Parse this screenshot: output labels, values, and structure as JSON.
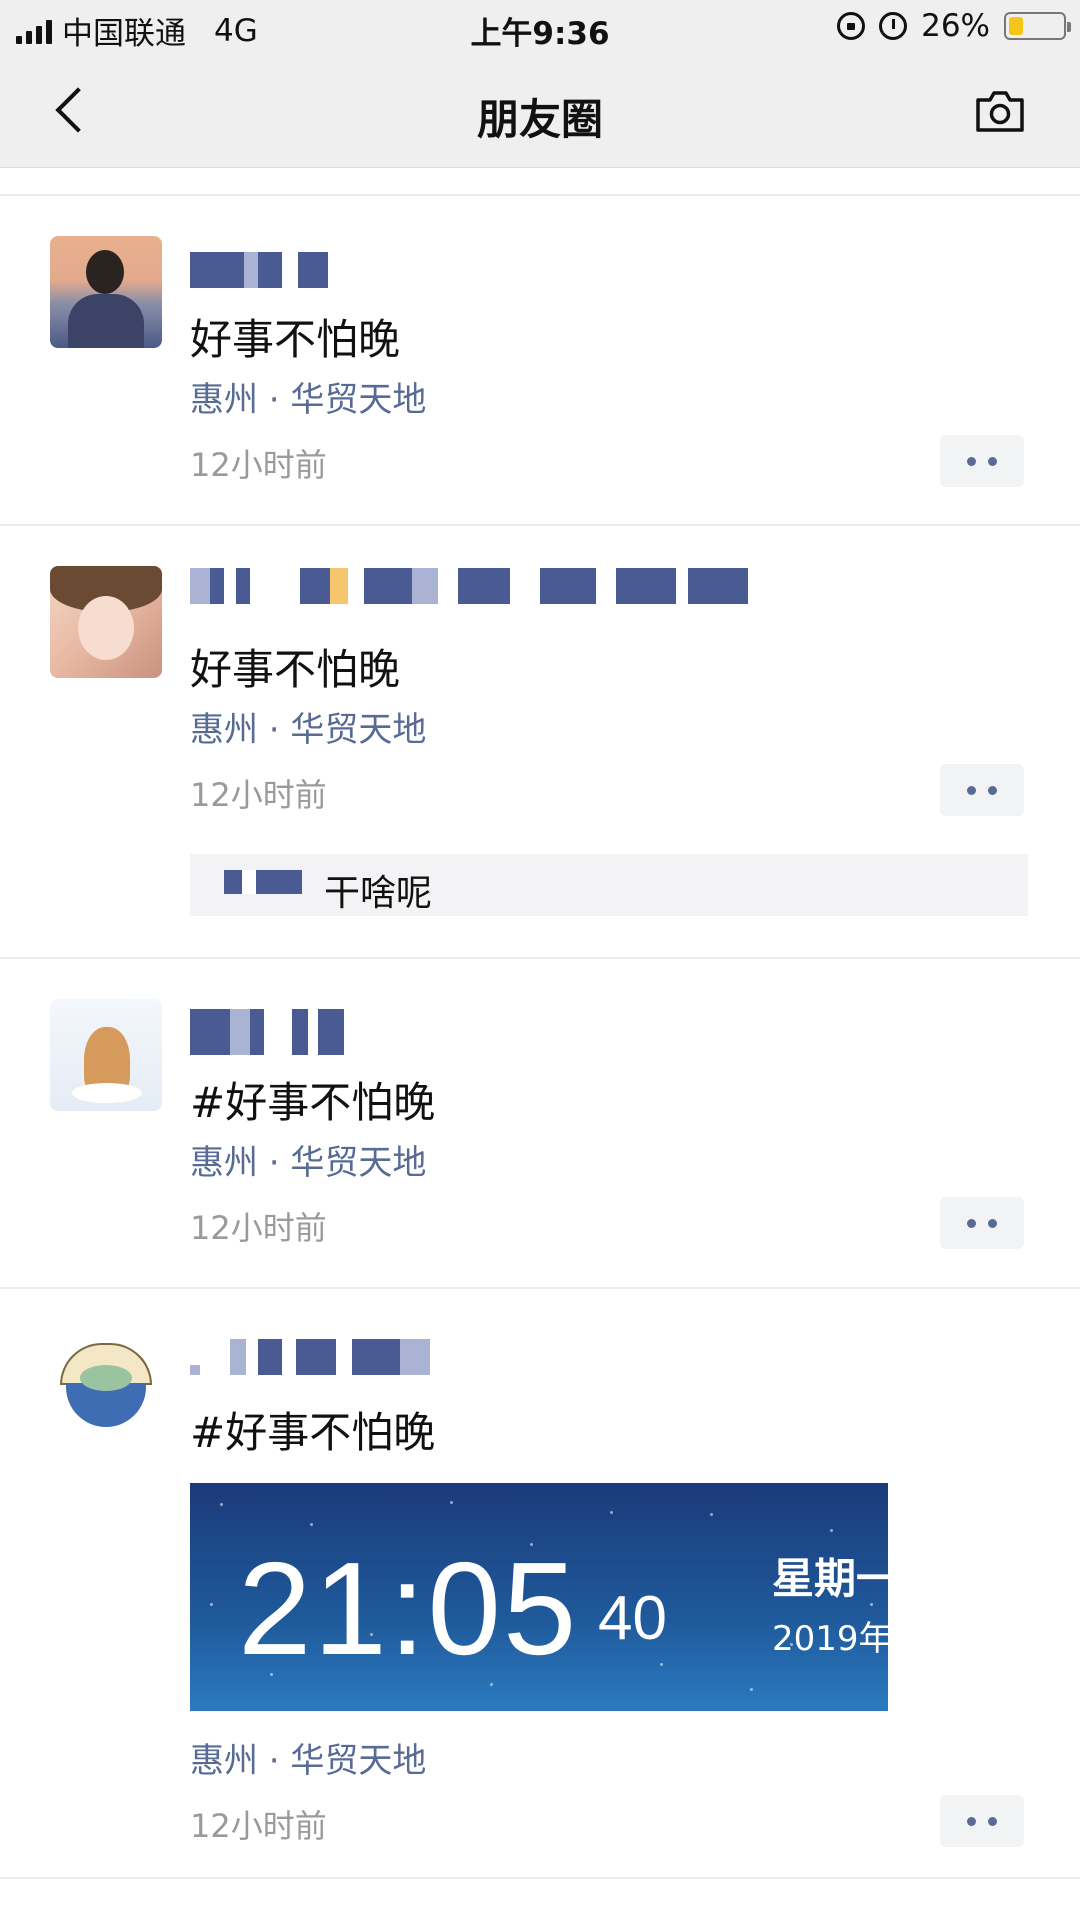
{
  "status_bar": {
    "carrier": "中国联通",
    "network": "4G",
    "time": "上午9:36",
    "battery": "26%",
    "battery_level": 0.26
  },
  "nav": {
    "title": "朋友圈"
  },
  "posts": [
    {
      "text": "好事不怕晚",
      "location": "惠州 · 华贸天地",
      "time_ago": "12小时前"
    },
    {
      "text": "好事不怕晚",
      "location": "惠州 · 华贸天地",
      "time_ago": "12小时前",
      "comment": "干啥呢"
    },
    {
      "text": "#好事不怕晚",
      "location": "惠州 · 华贸天地",
      "time_ago": "12小时前"
    },
    {
      "text": "#好事不怕晚",
      "location": "惠州 · 华贸天地",
      "time_ago": "12小时前",
      "image": {
        "time": "21:05",
        "seconds": "40",
        "weekday": "星期一",
        "date": "2019年"
      }
    }
  ],
  "colors": {
    "link": "#576b95",
    "nav_bg": "#efefef"
  },
  "icons": [
    "signal-icon",
    "rotation-lock-icon",
    "alarm-icon",
    "battery-icon",
    "back-chevron-icon",
    "camera-icon",
    "more-dots-icon"
  ]
}
